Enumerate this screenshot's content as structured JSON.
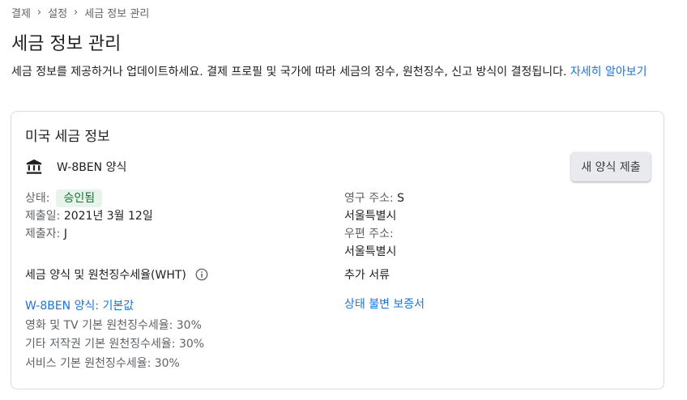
{
  "breadcrumb": {
    "items": [
      "결제",
      "설정",
      "세금 정보 관리"
    ]
  },
  "page": {
    "title": "세금 정보 관리",
    "description": "세금 정보를 제공하거나 업데이트하세요. 결제 프로필 및 국가에 따라 세금의 징수, 원천징수, 신고 방식이 결정됩니다.",
    "learn_more": "자세히 알아보기"
  },
  "card": {
    "title": "미국 세금 정보",
    "form_icon": "bank-icon",
    "form_name": "W-8BEN 양식",
    "new_form_button": "새 양식 제출",
    "status_label": "상태:",
    "status_value": "승인됨",
    "submitted_label": "제출일:",
    "submitted_value": "2021년 3월 12일",
    "submitter_label": "제출자:",
    "submitter_value": "J",
    "permanent_address_label": "영구 주소:",
    "permanent_address_value": "S",
    "permanent_address_line2": "서울특별시",
    "mailing_address_label": "우편 주소:",
    "mailing_address_line": "서울특별시",
    "wht_heading": "세금 양식 및 원천징수세율(WHT)",
    "wht_link": "W-8BEN 양식: 기본값",
    "wht_rates": [
      "영화 및 TV 기본 원천징수세율: 30%",
      "기타 저작권 기본 원천징수세율: 30%",
      "서비스 기본 원천징수세율: 30%"
    ],
    "docs_heading": "추가 서류",
    "docs_link": "상태 불변 보증서"
  },
  "colors": {
    "link": "#1a73e8",
    "status_bg": "#e6f4ea",
    "status_text": "#137333"
  }
}
